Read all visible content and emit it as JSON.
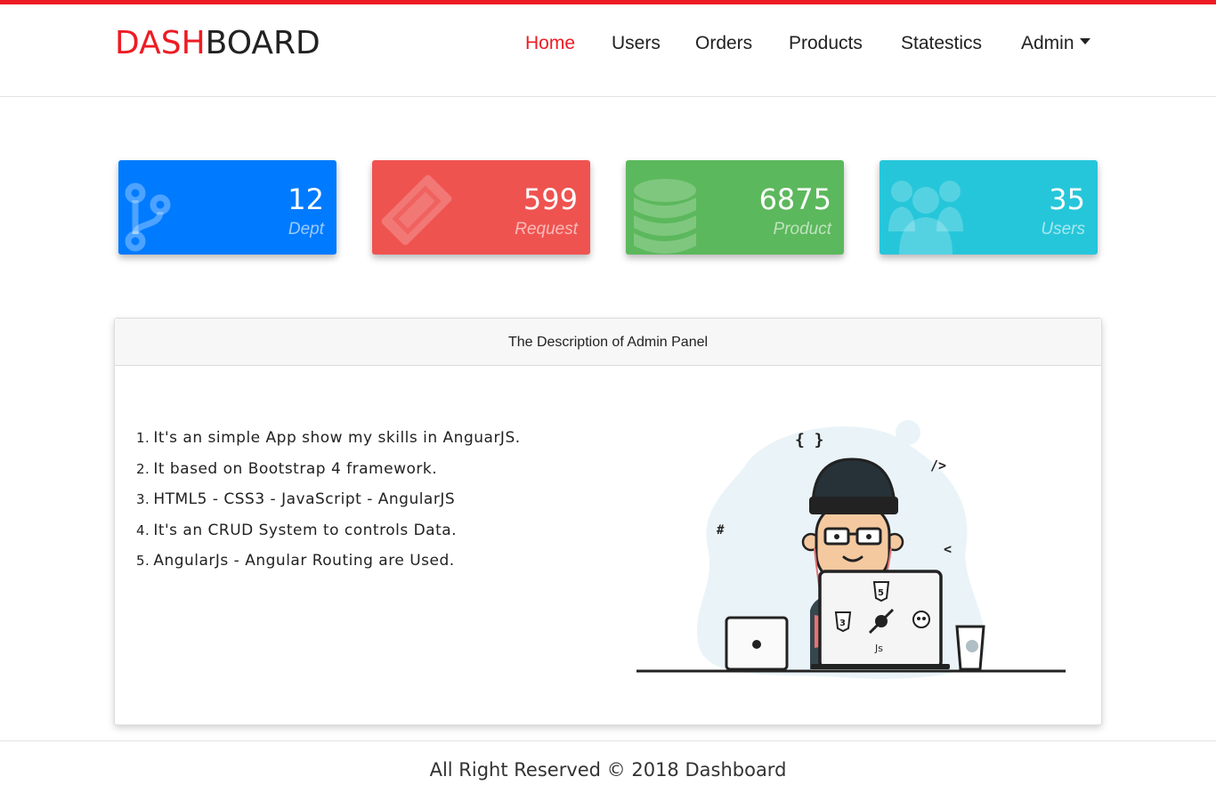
{
  "brand": {
    "part1": "DASH",
    "part2": "BOARD"
  },
  "nav": {
    "home": "Home",
    "users": "Users",
    "orders": "Orders",
    "products": "Products",
    "statistics": "Statestics",
    "admin": "Admin"
  },
  "cards": [
    {
      "value": "12",
      "label": "Dept",
      "color": "#007bff",
      "icon": "code-branch-icon"
    },
    {
      "value": "599",
      "label": "Request",
      "color": "#ef5350",
      "icon": "ticket-icon"
    },
    {
      "value": "6875",
      "label": "Product",
      "color": "#5cb85c",
      "icon": "database-icon"
    },
    {
      "value": "35",
      "label": "Users",
      "color": "#26c6da",
      "icon": "users-icon"
    }
  ],
  "panel": {
    "title": "The Description of Admin Panel",
    "items": [
      "It's an simple App show my skills in AnguarJS.",
      "It based on Bootstrap 4 framework.",
      "HTML5 - CSS3 - JavaScript - AngularJS",
      "It's an CRUD System to controls Data.",
      "AngularJs - Angular Routing are Used."
    ],
    "illustration": {
      "braces": "{ }",
      "tag": "/>",
      "hash": "#",
      "chev": "<",
      "js": "Js",
      "html5": "5",
      "css3": "3"
    }
  },
  "footer": {
    "text": "All Right Reserved © 2018 Dashboard"
  }
}
